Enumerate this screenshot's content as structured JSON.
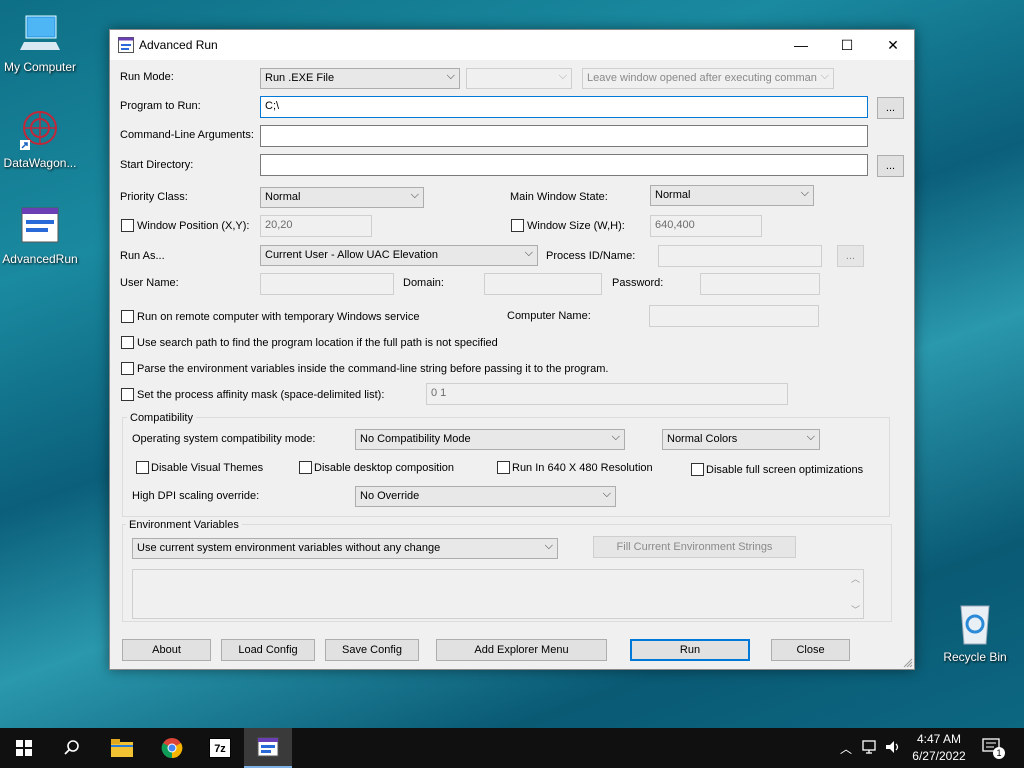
{
  "desktop": {
    "icons": [
      {
        "label": "My Computer"
      },
      {
        "label": "DataWagon..."
      },
      {
        "label": "AdvancedRun"
      },
      {
        "label": "Recycle Bin"
      }
    ]
  },
  "window": {
    "title": "Advanced Run",
    "controls": {
      "minimize": "—",
      "maximize": "☐",
      "close": "✕"
    }
  },
  "form": {
    "run_mode_label": "Run Mode:",
    "run_mode_value": "Run .EXE File",
    "run_mode_second_value": "",
    "leave_window_value": "Leave window opened after executing comman",
    "program_label": "Program to Run:",
    "program_value": "C;\\",
    "browse_label": "...",
    "args_label": "Command-Line Arguments:",
    "args_value": "",
    "start_dir_label": "Start Directory:",
    "start_dir_value": "",
    "priority_label": "Priority Class:",
    "priority_value": "Normal",
    "main_window_state_label": "Main Window State:",
    "main_window_state_value": "Normal",
    "window_position_label": "Window Position (X,Y):",
    "window_position_value": "20,20",
    "window_size_label": "Window Size (W,H):",
    "window_size_value": "640,400",
    "run_as_label": "Run As...",
    "run_as_value": "Current User - Allow UAC Elevation",
    "process_id_label": "Process ID/Name:",
    "process_id_value": "",
    "username_label": "User Name:",
    "domain_label": "Domain:",
    "password_label": "Password:",
    "remote_label": "Run on remote computer with temporary Windows service",
    "computer_name_label": "Computer Name:",
    "search_path_label": "Use search path to find the program location if the full path is not specified",
    "parse_env_label": "Parse the environment variables inside the command-line string before passing it to the program.",
    "affinity_label": "Set the process affinity mask (space-delimited list):",
    "affinity_value": "0 1"
  },
  "compat": {
    "group_label": "Compatibility",
    "os_mode_label": "Operating system compatibility mode:",
    "os_mode_value": "No Compatibility Mode",
    "colors_value": "Normal Colors",
    "disable_themes_label": "Disable Visual Themes",
    "disable_desktop_comp_label": "Disable desktop composition",
    "run_640_label": "Run In 640 X 480 Resolution",
    "disable_fullscreen_label": "Disable full screen optimizations",
    "dpi_label": "High DPI scaling override:",
    "dpi_value": "No Override"
  },
  "env": {
    "group_label": "Environment Variables",
    "mode_value": "Use current system environment variables without any change",
    "fill_button": "Fill Current Environment Strings"
  },
  "buttons": {
    "about": "About",
    "load": "Load Config",
    "save": "Save Config",
    "add_explorer": "Add Explorer Menu",
    "run": "Run",
    "close": "Close"
  },
  "taskbar": {
    "time": "4:47 AM",
    "date": "6/27/2022",
    "notification_count": "1",
    "sevenzip_label": "7z"
  },
  "colors": {
    "accent": "#0078d7",
    "taskbar": "#101010"
  }
}
